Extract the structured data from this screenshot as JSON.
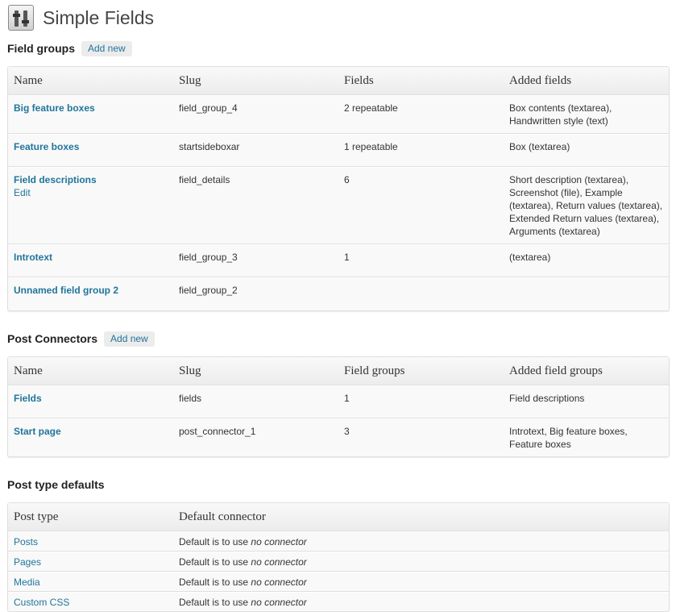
{
  "page": {
    "title": "Simple Fields"
  },
  "field_groups": {
    "heading": "Field groups",
    "add_new": "Add new",
    "columns": [
      "Name",
      "Slug",
      "Fields",
      "Added fields"
    ],
    "rows": [
      {
        "name": "Big feature boxes",
        "edit": "",
        "slug": "field_group_4",
        "fields": "2 repeatable",
        "added": "Box contents (textarea), Handwritten style (text)"
      },
      {
        "name": "Feature boxes",
        "edit": "",
        "slug": "startsideboxar",
        "fields": "1 repeatable",
        "added": "Box (textarea)"
      },
      {
        "name": "Field descriptions",
        "edit": "Edit",
        "slug": "field_details",
        "fields": "6",
        "added": "Short description (textarea), Screenshot (file), Example (textarea), Return values (textarea), Extended Return values (textarea), Arguments (textarea)"
      },
      {
        "name": "Introtext",
        "edit": "",
        "slug": "field_group_3",
        "fields": "1",
        "added": "(textarea)"
      },
      {
        "name": "Unnamed field group 2",
        "edit": "",
        "slug": "field_group_2",
        "fields": "",
        "added": ""
      }
    ]
  },
  "post_connectors": {
    "heading": "Post Connectors",
    "add_new": "Add new",
    "columns": [
      "Name",
      "Slug",
      "Field groups",
      "Added field groups"
    ],
    "rows": [
      {
        "name": "Fields",
        "slug": "fields",
        "count": "1",
        "added": "Field descriptions"
      },
      {
        "name": "Start page",
        "slug": "post_connector_1",
        "count": "3",
        "added": "Introtext, Big feature boxes, Feature boxes"
      }
    ]
  },
  "post_type_defaults": {
    "heading": "Post type defaults",
    "columns": [
      "Post type",
      "Default connector"
    ],
    "default_prefix": "Default is to use",
    "default_value": "no connector",
    "rows": [
      {
        "type": "Posts"
      },
      {
        "type": "Pages"
      },
      {
        "type": "Media"
      },
      {
        "type": "Custom CSS"
      }
    ]
  }
}
